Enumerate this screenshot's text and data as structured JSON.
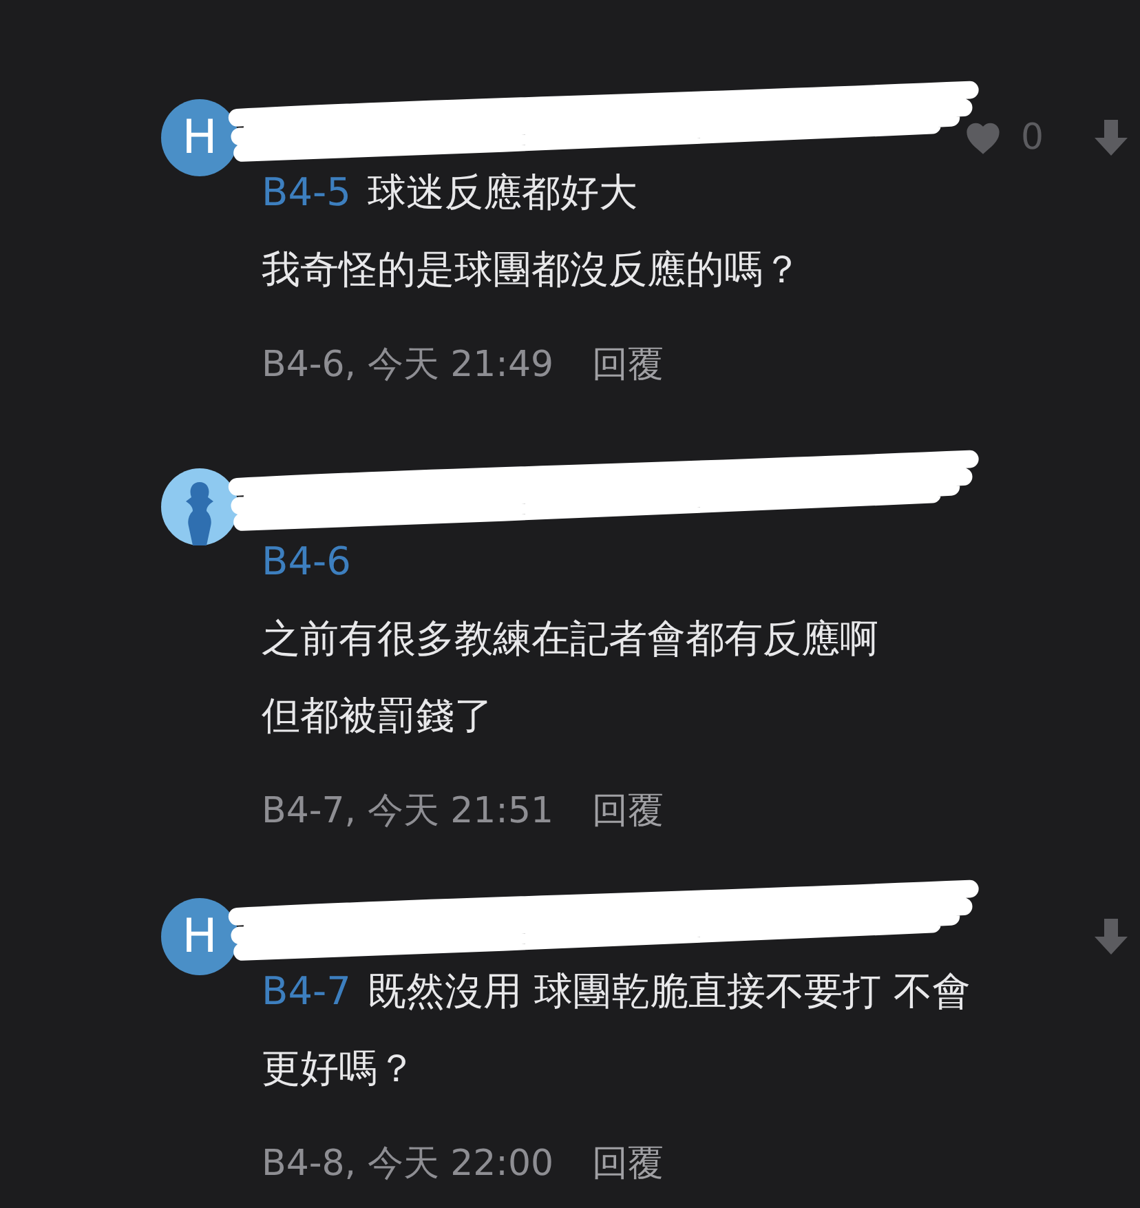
{
  "comments": [
    {
      "avatar": {
        "kind": "letter",
        "text": "H"
      },
      "likes": "0",
      "vote_down": true,
      "reply_to": "B4-5",
      "reply_to_own_line": false,
      "lines": [
        "球迷反應都好大",
        "我奇怪的是球團都沒反應的嗎？"
      ],
      "meta": "B4-6, 今天 21:49",
      "reply": "回覆"
    },
    {
      "avatar": {
        "kind": "figure"
      },
      "vote_down": false,
      "reply_to": "B4-6",
      "reply_to_own_line": true,
      "lines": [
        "之前有很多教練在記者會都有反應啊",
        "但都被罰錢了"
      ],
      "meta": "B4-7, 今天 21:51",
      "reply": "回覆"
    },
    {
      "avatar": {
        "kind": "letter",
        "text": "H"
      },
      "vote_down": true,
      "reply_to": "B4-7",
      "reply_to_own_line": false,
      "lines": [
        "既然沒用 球團乾脆直接不要打 不會",
        "更好嗎？"
      ],
      "meta": "B4-8, 今天 22:00",
      "reply": "回覆"
    }
  ]
}
